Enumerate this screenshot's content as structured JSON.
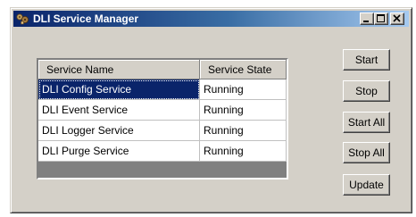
{
  "window": {
    "title": "DLI Service Manager"
  },
  "table": {
    "columns": [
      "Service Name",
      "Service State"
    ],
    "rows": [
      {
        "name": "DLI Config Service",
        "state": "Running"
      },
      {
        "name": "DLI Event Service",
        "state": "Running"
      },
      {
        "name": "DLI Logger Service",
        "state": "Running"
      },
      {
        "name": "DLI Purge Service",
        "state": "Running"
      }
    ],
    "selected_row": 0
  },
  "buttons": {
    "start": "Start",
    "stop": "Stop",
    "start_all": "Start All",
    "stop_all": "Stop All",
    "update": "Update"
  },
  "caption_buttons": [
    "minimize",
    "maximize",
    "close"
  ],
  "colors": {
    "title_gradient_start": "#0a246a",
    "title_gradient_end": "#a6caf0",
    "selection": "#0a246a",
    "face": "#d4d0c8"
  }
}
